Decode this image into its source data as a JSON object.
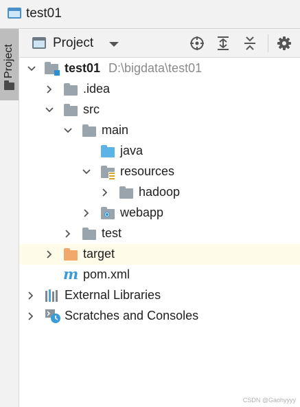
{
  "window": {
    "title": "test01"
  },
  "tool_strip": {
    "tab_label": "Project",
    "icon": "folder-icon"
  },
  "toolbar": {
    "view_label": "Project",
    "icons": [
      "locate-icon",
      "expand-all-icon",
      "collapse-all-icon",
      "gear-icon"
    ]
  },
  "tree": [
    {
      "label": "test01",
      "path": "D:\\bigdata\\test01",
      "icon": "module-folder-icon",
      "expanded": true
    },
    {
      "label": ".idea",
      "icon": "folder-icon",
      "expanded": false
    },
    {
      "label": "src",
      "icon": "folder-icon",
      "expanded": true
    },
    {
      "label": "main",
      "icon": "folder-icon",
      "expanded": true
    },
    {
      "label": "java",
      "icon": "source-folder-icon"
    },
    {
      "label": "resources",
      "icon": "resources-folder-icon",
      "expanded": true
    },
    {
      "label": "hadoop",
      "icon": "folder-icon",
      "expanded": false
    },
    {
      "label": "webapp",
      "icon": "web-folder-icon",
      "expanded": false
    },
    {
      "label": "test",
      "icon": "folder-icon",
      "expanded": false
    },
    {
      "label": "target",
      "icon": "excluded-folder-icon",
      "expanded": false,
      "highlight": "#fefce8"
    },
    {
      "label": "pom.xml",
      "icon": "maven-icon"
    },
    {
      "label": "External Libraries",
      "icon": "libraries-icon",
      "expanded": false
    },
    {
      "label": "Scratches and Consoles",
      "icon": "scratches-icon",
      "expanded": false
    }
  ],
  "watermark": "CSDN @Gaohyyyy"
}
